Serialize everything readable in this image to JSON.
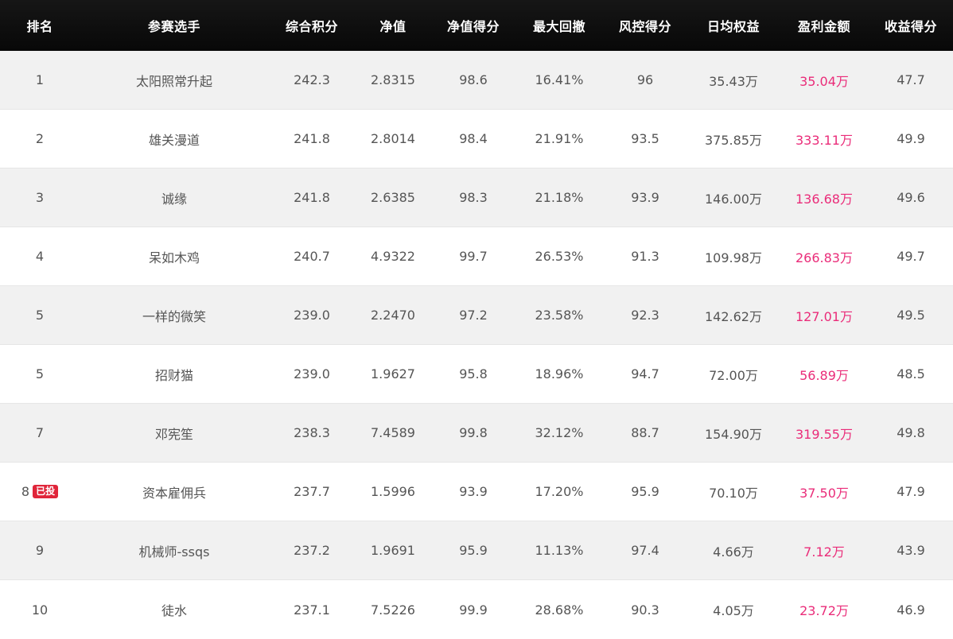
{
  "headers": [
    "排名",
    "参赛选手",
    "综合积分",
    "净值",
    "净值得分",
    "最大回撤",
    "风控得分",
    "日均权益",
    "盈利金额",
    "收益得分"
  ],
  "rows": [
    {
      "rank": "1",
      "badge": "",
      "name": "太阳照常升起",
      "score": "242.3",
      "nav": "2.8315",
      "nav_score": "98.6",
      "max_drawdown": "16.41%",
      "risk_score": "96",
      "avg_equity": "35.43万",
      "profit": "35.04万",
      "return_score": "47.7"
    },
    {
      "rank": "2",
      "badge": "",
      "name": "雄关漫道",
      "score": "241.8",
      "nav": "2.8014",
      "nav_score": "98.4",
      "max_drawdown": "21.91%",
      "risk_score": "93.5",
      "avg_equity": "375.85万",
      "profit": "333.11万",
      "return_score": "49.9"
    },
    {
      "rank": "3",
      "badge": "",
      "name": "诚缘",
      "score": "241.8",
      "nav": "2.6385",
      "nav_score": "98.3",
      "max_drawdown": "21.18%",
      "risk_score": "93.9",
      "avg_equity": "146.00万",
      "profit": "136.68万",
      "return_score": "49.6"
    },
    {
      "rank": "4",
      "badge": "",
      "name": "呆如木鸡",
      "score": "240.7",
      "nav": "4.9322",
      "nav_score": "99.7",
      "max_drawdown": "26.53%",
      "risk_score": "91.3",
      "avg_equity": "109.98万",
      "profit": "266.83万",
      "return_score": "49.7"
    },
    {
      "rank": "5",
      "badge": "",
      "name": "一样的微笑",
      "score": "239.0",
      "nav": "2.2470",
      "nav_score": "97.2",
      "max_drawdown": "23.58%",
      "risk_score": "92.3",
      "avg_equity": "142.62万",
      "profit": "127.01万",
      "return_score": "49.5"
    },
    {
      "rank": "5",
      "badge": "",
      "name": "招财猫",
      "score": "239.0",
      "nav": "1.9627",
      "nav_score": "95.8",
      "max_drawdown": "18.96%",
      "risk_score": "94.7",
      "avg_equity": "72.00万",
      "profit": "56.89万",
      "return_score": "48.5"
    },
    {
      "rank": "7",
      "badge": "",
      "name": "邓宪笙",
      "score": "238.3",
      "nav": "7.4589",
      "nav_score": "99.8",
      "max_drawdown": "32.12%",
      "risk_score": "88.7",
      "avg_equity": "154.90万",
      "profit": "319.55万",
      "return_score": "49.8"
    },
    {
      "rank": "8",
      "badge": "已投",
      "name": "资本雇佣兵",
      "score": "237.7",
      "nav": "1.5996",
      "nav_score": "93.9",
      "max_drawdown": "17.20%",
      "risk_score": "95.9",
      "avg_equity": "70.10万",
      "profit": "37.50万",
      "return_score": "47.9"
    },
    {
      "rank": "9",
      "badge": "",
      "name": "机械师-ssqs",
      "score": "237.2",
      "nav": "1.9691",
      "nav_score": "95.9",
      "max_drawdown": "11.13%",
      "risk_score": "97.4",
      "avg_equity": "4.66万",
      "profit": "7.12万",
      "return_score": "43.9"
    },
    {
      "rank": "10",
      "badge": "",
      "name": "徒水",
      "score": "237.1",
      "nav": "7.5226",
      "nav_score": "99.9",
      "max_drawdown": "28.68%",
      "risk_score": "90.3",
      "avg_equity": "4.05万",
      "profit": "23.72万",
      "return_score": "46.9"
    }
  ],
  "colors": {
    "header_bg": "#0d0d0d",
    "header_text": "#ffffff",
    "odd_row_bg": "#f1f1f1",
    "even_row_bg": "#ffffff",
    "body_text": "#555555",
    "profit_text": "#ea2c79",
    "badge_bg": "#e0253a"
  }
}
